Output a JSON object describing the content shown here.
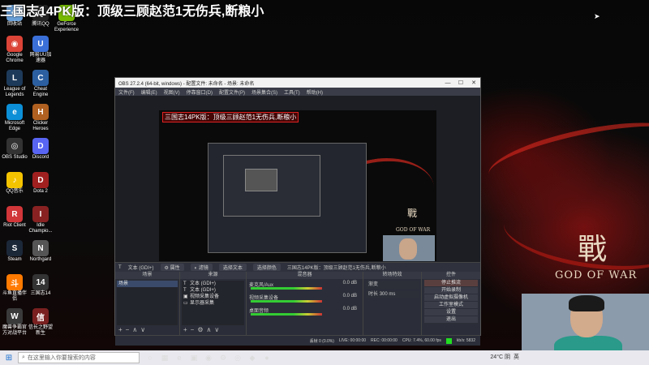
{
  "stream_title": "三国志14PK版：顶级三顾赵范1无伤兵,断粮小",
  "desktop_icons": [
    {
      "label": "回收站",
      "glyph": "♻",
      "color": "#6aa0d8"
    },
    {
      "label": "腾讯QQ",
      "glyph": "Q",
      "color": "#222"
    },
    {
      "label": "GeForce Experience",
      "glyph": "G",
      "color": "#76b900"
    },
    {
      "label": "Google Chrome",
      "glyph": "◉",
      "color": "#db4437"
    },
    {
      "label": "网易UU加速器",
      "glyph": "U",
      "color": "#3a6fd8"
    },
    {
      "label": "League of Legends",
      "glyph": "L",
      "color": "#1e3a5a"
    },
    {
      "label": "Cheat Engine",
      "glyph": "C",
      "color": "#2b5fa0"
    },
    {
      "label": "Microsoft Edge",
      "glyph": "e",
      "color": "#0c8fd6"
    },
    {
      "label": "Clicker Heroes",
      "glyph": "H",
      "color": "#b06020"
    },
    {
      "label": "OBS Studio",
      "glyph": "◎",
      "color": "#333"
    },
    {
      "label": "Discord",
      "glyph": "D",
      "color": "#5865f2"
    },
    {
      "label": "QQ音乐",
      "glyph": "♪",
      "color": "#f5c400"
    },
    {
      "label": "Dota 2",
      "glyph": "D",
      "color": "#a02020"
    },
    {
      "label": "Riot Client",
      "glyph": "R",
      "color": "#d13639"
    },
    {
      "label": "Idle Champio...",
      "glyph": "I",
      "color": "#882222"
    },
    {
      "label": "Steam",
      "glyph": "S",
      "color": "#1b2838"
    },
    {
      "label": "Northgard",
      "glyph": "N",
      "color": "#555"
    },
    {
      "label": "斗鱼直播伴侣",
      "glyph": "斗",
      "color": "#ff7a00"
    },
    {
      "label": "三国志14",
      "glyph": "14",
      "color": "#333"
    },
    {
      "label": "魔兽争霸官方对战平台",
      "glyph": "W",
      "color": "#3a3a3a"
    },
    {
      "label": "信长之野望新生",
      "glyph": "信",
      "color": "#7a2020"
    }
  ],
  "obs": {
    "title": "OBS 27.2.4 (64-bit, windows) - 配置文件: 未命名 - 场景: 未命名",
    "menu": [
      "文件(F)",
      "编辑(E)",
      "视图(V)",
      "停靠窗口(D)",
      "配置文件(P)",
      "场景集合(S)",
      "工具(T)",
      "帮助(H)"
    ],
    "preview_title": "三国志14PK版：顶级三顾赵范1无伤兵,断粮小",
    "source_bar": {
      "current": "文本 (GDI+)",
      "properties": "属性",
      "filters": "滤镜",
      "select_text": "选择文本",
      "select_color": "选择颜色",
      "text_value": "三国志14PK版：顶级三顾赵范1无伤兵,断粮小"
    },
    "docks": {
      "scenes": {
        "header": "场景",
        "items": [
          "场景"
        ]
      },
      "sources": {
        "header": "来源",
        "items": [
          {
            "icon": "T",
            "name": "文本 (GDI+)"
          },
          {
            "icon": "T",
            "name": "文本 (GDI+)"
          },
          {
            "icon": "▣",
            "name": "视频采集设备"
          },
          {
            "icon": "▭",
            "name": "显示器采集"
          }
        ]
      },
      "mixer": {
        "header": "混音器",
        "rows": [
          {
            "name": "麦克风/Aux",
            "db": "0.0 dB"
          },
          {
            "name": "视频采集设备",
            "db": "0.0 dB"
          },
          {
            "name": "桌面音频",
            "db": "0.0 dB"
          }
        ]
      },
      "transitions": {
        "header": "转场特效",
        "type": "渐变",
        "duration_label": "时长",
        "duration": "300 ms"
      },
      "controls": {
        "header": "控件",
        "buttons": [
          "停止推流",
          "开始录制",
          "启动虚拟摄像机",
          "工作室模式",
          "设置",
          "退出"
        ]
      }
    },
    "status": {
      "dropped": "丢帧 0 (0.0%)",
      "live": "LIVE: 00:00:00",
      "rec": "REC: 00:00:00",
      "cpu": "CPU: 7.4%, 60.00 fps",
      "kbps": "kb/s: 5832"
    }
  },
  "wallpaper": {
    "glyph": "戰",
    "title": "GOD OF WAR"
  },
  "taskbar": {
    "search_placeholder": "在这里输入你要搜索的内容",
    "apps": [
      "○",
      "▦",
      "e",
      "▣",
      "◉",
      "⚙",
      "◎",
      "◆",
      "●"
    ],
    "weather": "24°C 阴",
    "input": "英"
  }
}
